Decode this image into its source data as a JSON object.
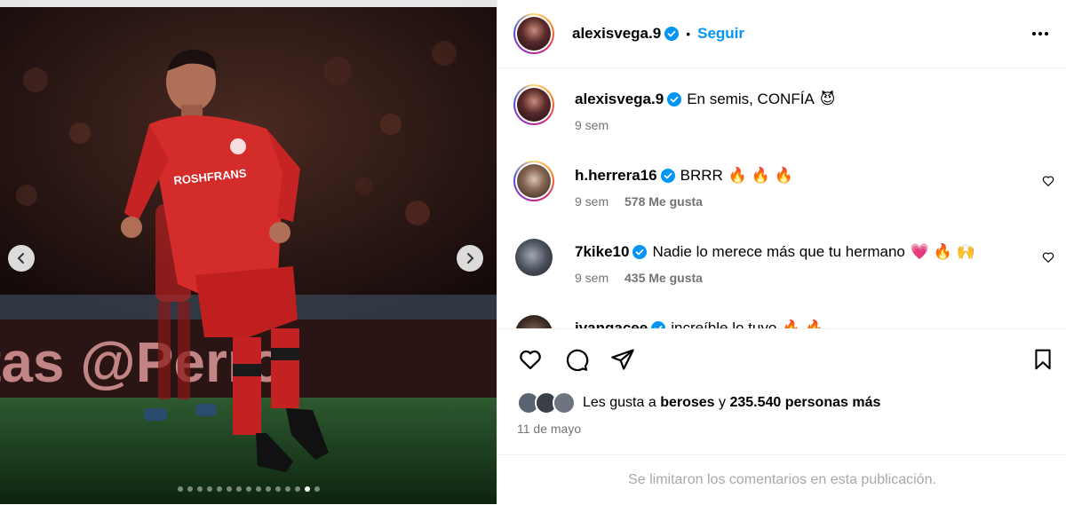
{
  "post": {
    "author": "alexisvega.9",
    "follow_label": "Seguir",
    "separator": "•",
    "caption_text": "En semis, CONFÍA",
    "caption_emoji": "😈",
    "caption_time": "9 sem"
  },
  "media": {
    "jersey_sponsor": "ROSHFRANS",
    "banner_text": "tas  @Perro",
    "dot_count": 15,
    "active_dot": 13
  },
  "comments": [
    {
      "user": "h.herrera16",
      "text": "BRRR",
      "emoji": "🔥 🔥 🔥",
      "time": "9 sem",
      "likes": "578 Me gusta"
    },
    {
      "user": "7kike10",
      "text": "Nadie lo merece más que tu hermano",
      "emoji": "💗 🔥 🙌",
      "time": "9 sem",
      "likes": "435 Me gusta"
    },
    {
      "user": "ivangacee",
      "text": "increíble lo tuyo",
      "emoji": "🔥 🔥",
      "time": "",
      "likes": ""
    }
  ],
  "likes_summary": {
    "prefix": "Les gusta a",
    "user": "beroses",
    "conj": "y",
    "count": "235.540 personas más"
  },
  "date": "11 de mayo",
  "comments_limited": "Se limitaron los comentarios en esta publicación.",
  "colors": {
    "accent": "#0095f6",
    "verified": "#0095f6",
    "muted": "#737373",
    "jersey": "#d42b2b"
  }
}
